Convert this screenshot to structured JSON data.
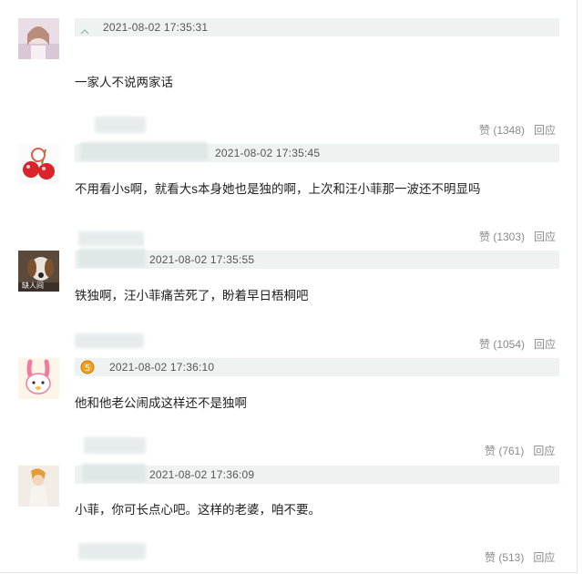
{
  "comments": [
    {
      "time": "2021-08-02 17:35:31",
      "text": "一家人不说两家话",
      "likes": "赞 (1348)",
      "reply": "回应"
    },
    {
      "time": "2021-08-02 17:35:45",
      "text": "不用看小s啊，就看大s本身她也是独的啊，上次和汪小菲那一波还不明显吗",
      "likes": "赞 (1303)",
      "reply": "回应"
    },
    {
      "time": "2021-08-02 17:35:55",
      "text": "铁独啊，汪小菲痛苦死了，盼着早日梧桐吧",
      "likes": "赞 (1054)",
      "reply": "回应",
      "avatar_caption": "缺人间"
    },
    {
      "time": "2021-08-02 17:36:10",
      "text": "他和他老公闹成这样还不是独啊",
      "likes": "赞 (761)",
      "reply": "回应"
    },
    {
      "time": "2021-08-02 17:36:09",
      "text": "小菲，你可长点心吧。这样的老婆，咱不要。",
      "likes": "赞 (513)",
      "reply": "回应"
    }
  ],
  "colors": {
    "meta_bar": "#eef3f2",
    "meta_text": "#555555",
    "action_text": "#8a8a8a",
    "content_text": "#222222"
  }
}
